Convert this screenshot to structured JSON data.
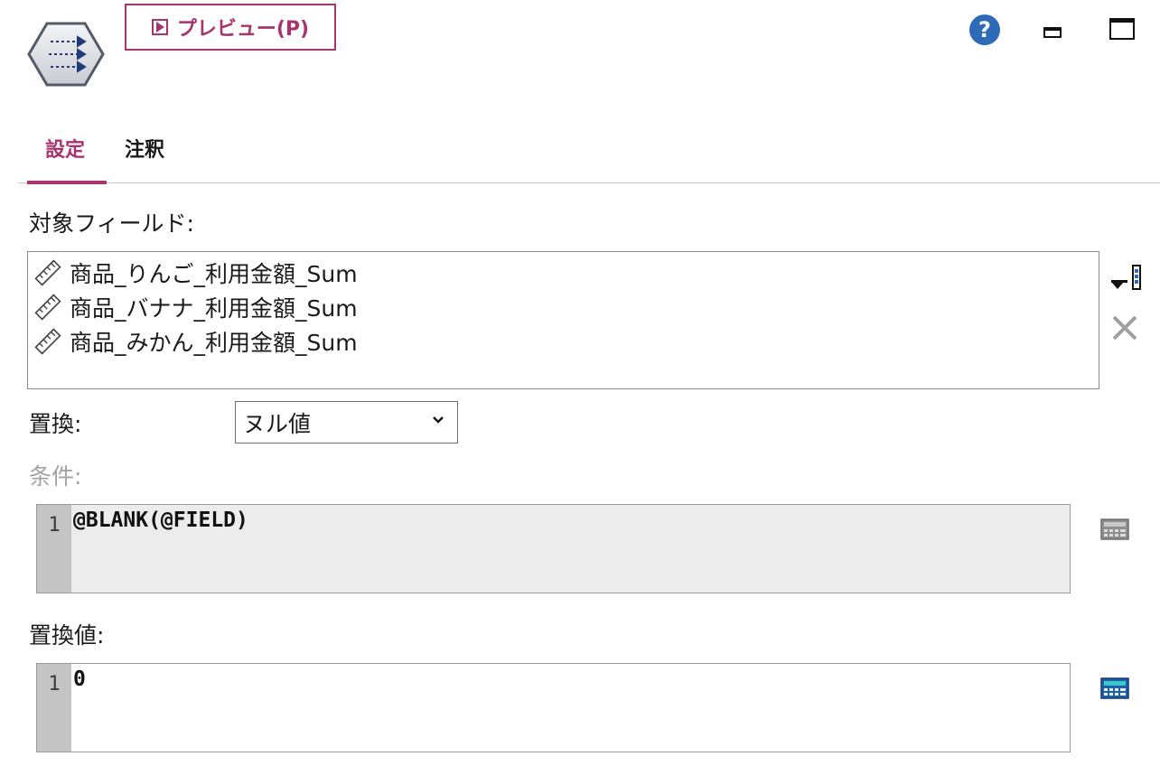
{
  "toolbar": {
    "preview_label": "プレビュー(P)",
    "help_symbol": "?"
  },
  "tabs": [
    {
      "label": "設定",
      "active": true
    },
    {
      "label": "注釈",
      "active": false
    }
  ],
  "fields": {
    "label": "対象フィールド:",
    "items": [
      "商品_りんご_利用金額_Sum",
      "商品_バナナ_利用金額_Sum",
      "商品_みかん_利用金額_Sum"
    ]
  },
  "replace": {
    "label": "置換:",
    "selected": "ヌル値"
  },
  "condition": {
    "label": "条件:",
    "line_number": "1",
    "code": "@BLANK(@FIELD)",
    "enabled": false
  },
  "replace_value": {
    "label": "置換値:",
    "line_number": "1",
    "code": "0"
  },
  "colors": {
    "accent": "#a8346e",
    "help_blue": "#2d6ab7",
    "disabled_text": "#a3a3a3",
    "gutter": "#c4c4c4"
  },
  "icons": {
    "node": "filler-node-icon",
    "field": "continuous-field-ruler-icon",
    "add_field": "field-picker-icon",
    "remove_field": "close-icon",
    "expression_builder": "calculator-icon"
  }
}
